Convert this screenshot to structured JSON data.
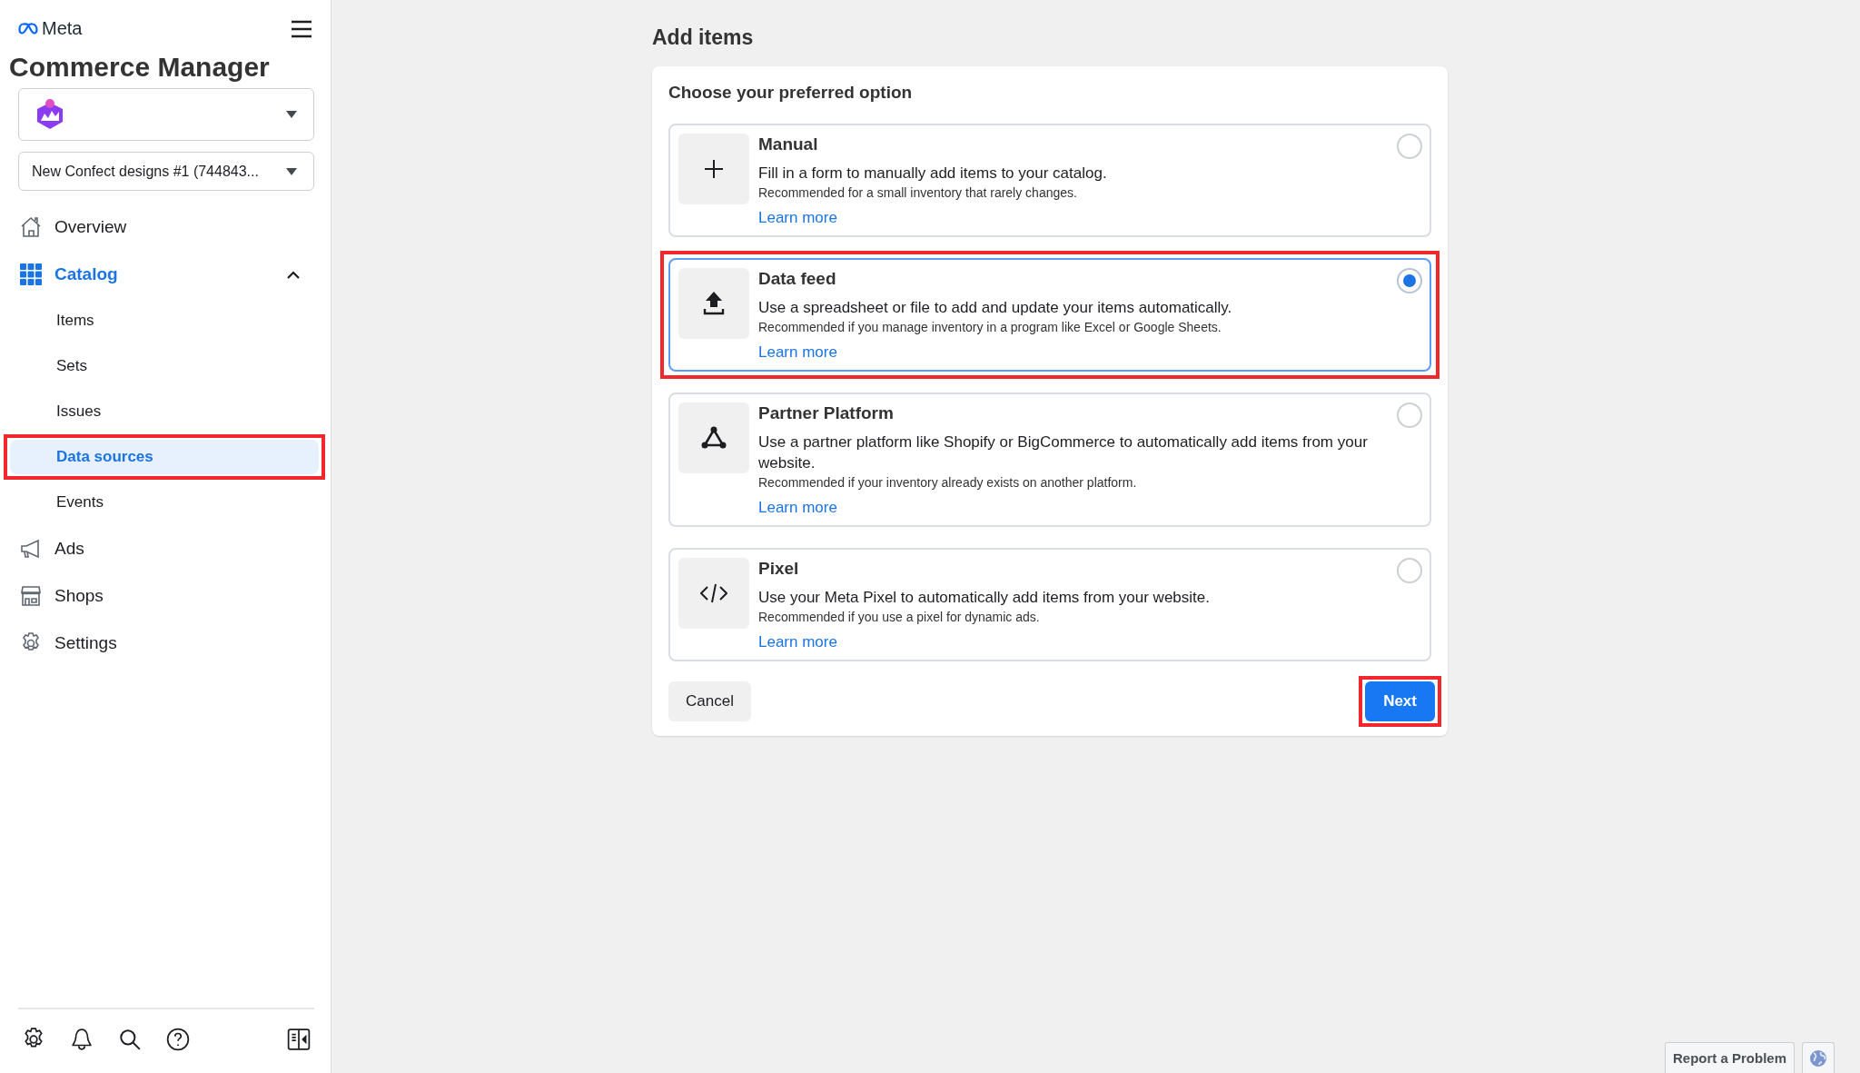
{
  "sidebar": {
    "logo": "Meta",
    "title": "Commerce Manager",
    "catalog_select": {
      "value": "New Confect designs #1 (744843..."
    },
    "nav": [
      {
        "label": "Overview",
        "selected": false
      },
      {
        "label": "Catalog",
        "selected": true,
        "expanded": true,
        "children": [
          {
            "label": "Items",
            "selected": false,
            "highlighted": false
          },
          {
            "label": "Sets",
            "selected": false,
            "highlighted": false
          },
          {
            "label": "Issues",
            "selected": false,
            "highlighted": false
          },
          {
            "label": "Data sources",
            "selected": true,
            "highlighted": true
          },
          {
            "label": "Events",
            "selected": false,
            "highlighted": false
          }
        ]
      },
      {
        "label": "Ads",
        "selected": false
      },
      {
        "label": "Shops",
        "selected": false
      },
      {
        "label": "Settings",
        "selected": false
      }
    ]
  },
  "page": {
    "title": "Add items",
    "prompt": "Choose your preferred option",
    "options": [
      {
        "title": "Manual",
        "description": "Fill in a form to manually add items to your catalog.",
        "note": "Recommended for a small inventory that rarely changes.",
        "link": "Learn more",
        "selected": false,
        "highlighted": false
      },
      {
        "title": "Data feed",
        "description": "Use a spreadsheet or file to add and update your items automatically.",
        "note": "Recommended if you manage inventory in a program like Excel or Google Sheets.",
        "link": "Learn more",
        "selected": true,
        "highlighted": true
      },
      {
        "title": "Partner Platform",
        "description": "Use a partner platform like Shopify or BigCommerce to automatically add items from your website.",
        "note": "Recommended if your inventory already exists on another platform.",
        "link": "Learn more",
        "selected": false,
        "highlighted": false
      },
      {
        "title": "Pixel",
        "description": "Use your Meta Pixel to automatically add items from your website.",
        "note": "Recommended if you use a pixel for dynamic ads.",
        "link": "Learn more",
        "selected": false,
        "highlighted": false
      }
    ],
    "cancel_button": "Cancel",
    "next_button": {
      "label": "Next",
      "highlighted": true
    }
  },
  "footer": {
    "report_button": "Report a Problem"
  }
}
